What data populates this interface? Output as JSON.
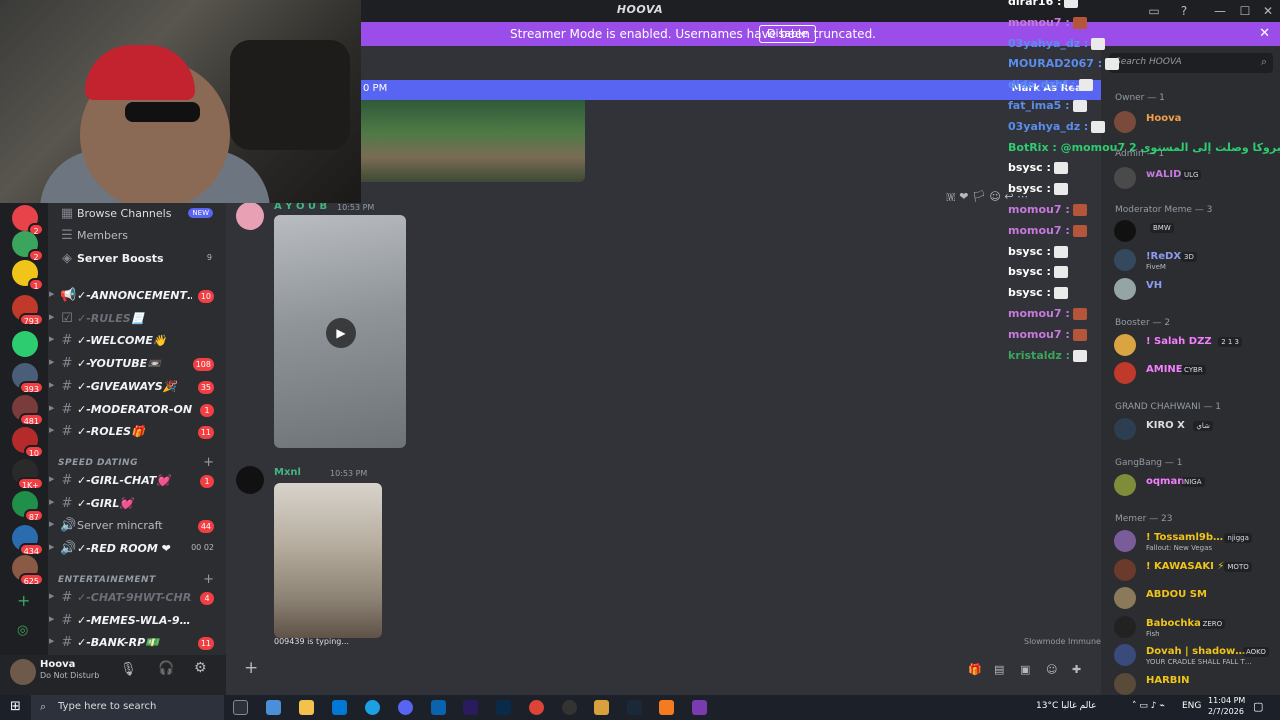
{
  "window": {
    "title": "HOOVA"
  },
  "banner": {
    "text": "Streamer Mode is enabled. Usernames have been truncated.",
    "disable_label": "Disable",
    "close": "✕"
  },
  "chat": {
    "new_messages": {
      "time": "0 PM",
      "mark_read": "Mark As Read"
    },
    "messages": [
      {
        "author": "A Y O U B",
        "time": "10:53 PM",
        "color": "#43b581"
      },
      {
        "author": "Mxnl",
        "time": "10:53 PM",
        "color": "#43b581"
      }
    ],
    "typing": "009439 is typing...",
    "slowmode": "Slowmode Immune"
  },
  "servers": [
    {
      "badge": "2",
      "color": "#e8434a"
    },
    {
      "badge": "2",
      "color": "#3ba55d"
    },
    {
      "badge": "1",
      "color": "#f0c419"
    },
    {
      "badge": "793",
      "color": "#c0392b"
    },
    {
      "badge": "",
      "color": "#2ecc71"
    },
    {
      "badge": "393",
      "color": "#4a5e7a"
    },
    {
      "badge": "481",
      "color": "#7a3b3b"
    },
    {
      "badge": "10",
      "color": "#b52b2b"
    },
    {
      "badge": "1K+",
      "color": "#2a2a2a"
    },
    {
      "badge": "87",
      "color": "#1f8f4a"
    },
    {
      "badge": "434",
      "color": "#2b6cb0"
    },
    {
      "badge": "625",
      "color": "#8a5a44"
    }
  ],
  "channels": {
    "top": [
      {
        "icon": "browse",
        "name": "Browse Channels",
        "badge": "NEW"
      },
      {
        "icon": "members",
        "name": "Members"
      },
      {
        "icon": "boost",
        "name": "Server Boosts",
        "count": "9"
      }
    ],
    "list": [
      {
        "name": "✓-ANNONCEMENT…",
        "count": "10",
        "icon": "📢"
      },
      {
        "name": "✓-RULES📃",
        "count": "",
        "icon": "☑",
        "muted": true
      },
      {
        "name": "✓-WELCOME👋",
        "count": "",
        "icon": "#"
      },
      {
        "name": "✓-YOUTUBE📼",
        "count": "108",
        "icon": "#"
      },
      {
        "name": "✓-GIVEAWAYS🎉",
        "count": "35",
        "icon": "#"
      },
      {
        "name": "✓-MODERATOR-ON…",
        "count": "1",
        "icon": "#"
      },
      {
        "name": "✓-ROLES🎁",
        "count": "11",
        "icon": "#"
      }
    ],
    "cat1": "SPEED DATING",
    "list2": [
      {
        "name": "✓-GIRL-CHAT💓",
        "count": "1",
        "icon": "#"
      },
      {
        "name": "✓-GIRL💓",
        "count": "",
        "icon": "#"
      },
      {
        "name": "Server mincraft",
        "count": "44",
        "icon": "🔊",
        "plain": true
      },
      {
        "name": "✓-RED ROOM ❤",
        "count": "",
        "icon": "🔊",
        "extra": "00  02"
      }
    ],
    "cat2": "ENTERTAINEMENT",
    "list3": [
      {
        "name": "✓-CHAT-9HWT-CHR…",
        "count": "4",
        "icon": "#",
        "muted": true
      },
      {
        "name": "✓-MEMES-WLA-9…",
        "count": "",
        "icon": "#"
      },
      {
        "name": "✓-BANK-RP💵",
        "count": "11",
        "icon": "#"
      }
    ]
  },
  "user": {
    "name": "Hoova",
    "status": "Do Not Disturb"
  },
  "livechat": [
    {
      "name": "dirar16 :",
      "color": "#ffffff"
    },
    {
      "name": "momou7 :",
      "color": "#c678dd"
    },
    {
      "name": "03yahya_dz :",
      "color": "#5b8def"
    },
    {
      "name": "MOURAD2067 :",
      "color": "#5b8def"
    },
    {
      "name": "dido_dzhf :",
      "color": "#5b8def"
    },
    {
      "name": "fat_ima5 :",
      "color": "#5b8def"
    },
    {
      "name": "03yahya_dz :",
      "color": "#5b8def"
    },
    {
      "name": "BotRix : @momou7 إمبروكا وصلت إلى المستوى 2",
      "color": "#2ecc71"
    },
    {
      "name": "bsysc :",
      "color": "#ffffff"
    },
    {
      "name": "bsysc :",
      "color": "#ffffff"
    },
    {
      "name": "momou7 :",
      "color": "#c678dd"
    },
    {
      "name": "momou7 :",
      "color": "#c678dd"
    },
    {
      "name": "bsysc :",
      "color": "#ffffff"
    },
    {
      "name": "bsysc :",
      "color": "#ffffff"
    },
    {
      "name": "bsysc :",
      "color": "#ffffff"
    },
    {
      "name": "momou7 :",
      "color": "#c678dd"
    },
    {
      "name": "momou7 :",
      "color": "#c678dd"
    },
    {
      "name": "kristaldz :",
      "color": "#3ba55d"
    }
  ],
  "search": {
    "placeholder": "Search HOOVA"
  },
  "members": {
    "roles": [
      "Owner — 1",
      "Admin — 1",
      "Moderator Meme — 3",
      "Booster — 2",
      "GRAND CHAHWANI — 1",
      "GangBang — 1",
      "Memer — 23"
    ],
    "people": [
      {
        "name": "Hoova",
        "color": "#f0a04b",
        "av": "#7a4a3a"
      },
      {
        "name": "wALID",
        "color": "#c678dd",
        "av": "#4a4a4a",
        "tag": "ULG"
      },
      {
        "name": "",
        "color": "#dbdee1",
        "av": "#111111",
        "tag": "BMW"
      },
      {
        "name": "!ReDX",
        "color": "#8e9cf0",
        "av": "#34495e",
        "tag": "3D",
        "sub": "FiveM"
      },
      {
        "name": "VH",
        "color": "#8e9cf0",
        "av": "#95a5a6"
      },
      {
        "name": "! Salah DZZ",
        "color": "#f47fff",
        "av": "#d9a441",
        "tag": "2 1 3"
      },
      {
        "name": "AMINE",
        "color": "#f47fff",
        "av": "#c0392b",
        "tag": "CYBR"
      },
      {
        "name": "KIRO  X",
        "color": "#dbdee1",
        "av": "#2c3e50",
        "tag": "شاي"
      },
      {
        "name": "oqman",
        "color": "#f47fff",
        "av": "#7f8c3a",
        "tag": "NIGA"
      },
      {
        "name": "! Tossaml9b…",
        "color": "#f0c419",
        "av": "#7a5c9a",
        "tag": "njigga",
        "sub": "Fallout: New Vegas"
      },
      {
        "name": "! KAWASAKI ⚡",
        "color": "#f0c419",
        "av": "#6a3a2a",
        "tag": "MOTO"
      },
      {
        "name": "ABDOU SM",
        "color": "#f0c419",
        "av": "#8a7a5a"
      },
      {
        "name": "Babochka",
        "color": "#f0c419",
        "av": "#222222",
        "tag": "ZERO",
        "sub": "Fish"
      },
      {
        "name": "Dovah | shadow…",
        "color": "#f0c419",
        "av": "#3a4a7a",
        "tag": "AOKO",
        "sub": "YOUR CRADLE SHALL FALL T…"
      },
      {
        "name": "HARBIN",
        "color": "#f0c419",
        "av": "#5a4a3a"
      }
    ]
  },
  "taskbar": {
    "search_placeholder": "Type here to search",
    "weather": "13°C عالم غالبا",
    "lang": "ENG",
    "time": "11:04 PM",
    "date": "2/7/2026"
  }
}
